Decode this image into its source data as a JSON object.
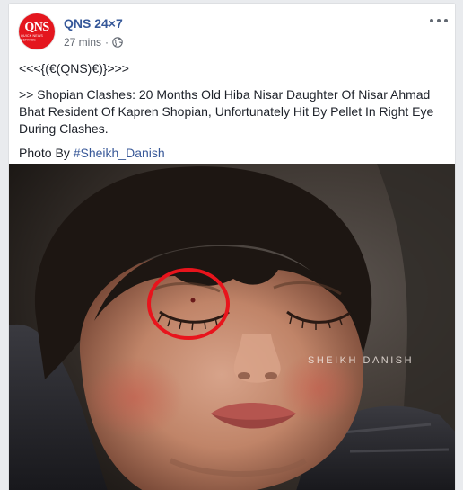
{
  "post": {
    "page_name": "QNS 24×7",
    "avatar_logo": "QNS",
    "avatar_sub": "QUICK NEWS SERVICE",
    "time": "27 mins",
    "separator": "·",
    "privacy_icon": "globe-icon",
    "more_icon": "more-options-icon",
    "line1": "<<<{(€(QNS)€)}>>>",
    "body": ">> Shopian Clashes: 20 Months Old Hiba Nisar Daughter Of Nisar Ahmad Bhat Resident Of Kapren Shopian, Unfortunately Hit By Pellet In Right Eye During Clashes.",
    "credit_prefix": "Photo By ",
    "credit_tag": "#Sheikh_Danish",
    "watermark": "SHEIKH DANISH"
  },
  "colors": {
    "link": "#365899",
    "meta": "#616770",
    "text": "#1d2129",
    "brand": "#e4161e",
    "highlight_circle": "#e8141c"
  }
}
